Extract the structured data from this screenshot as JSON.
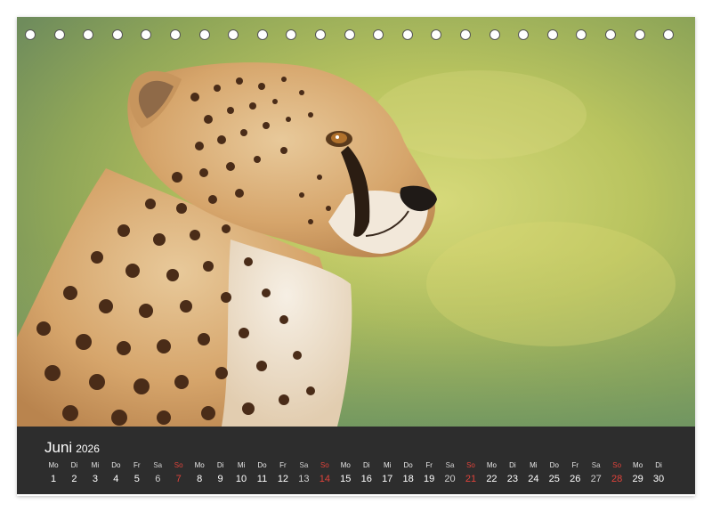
{
  "calendar": {
    "month": "Juni",
    "year": "2026",
    "days": [
      {
        "dow": "Mo",
        "num": "1",
        "type": "weekday"
      },
      {
        "dow": "Di",
        "num": "2",
        "type": "weekday"
      },
      {
        "dow": "Mi",
        "num": "3",
        "type": "weekday"
      },
      {
        "dow": "Do",
        "num": "4",
        "type": "weekday"
      },
      {
        "dow": "Fr",
        "num": "5",
        "type": "weekday"
      },
      {
        "dow": "Sa",
        "num": "6",
        "type": "sat"
      },
      {
        "dow": "So",
        "num": "7",
        "type": "sun"
      },
      {
        "dow": "Mo",
        "num": "8",
        "type": "weekday"
      },
      {
        "dow": "Di",
        "num": "9",
        "type": "weekday"
      },
      {
        "dow": "Mi",
        "num": "10",
        "type": "weekday"
      },
      {
        "dow": "Do",
        "num": "11",
        "type": "weekday"
      },
      {
        "dow": "Fr",
        "num": "12",
        "type": "weekday"
      },
      {
        "dow": "Sa",
        "num": "13",
        "type": "sat"
      },
      {
        "dow": "So",
        "num": "14",
        "type": "sun"
      },
      {
        "dow": "Mo",
        "num": "15",
        "type": "weekday"
      },
      {
        "dow": "Di",
        "num": "16",
        "type": "weekday"
      },
      {
        "dow": "Mi",
        "num": "17",
        "type": "weekday"
      },
      {
        "dow": "Do",
        "num": "18",
        "type": "weekday"
      },
      {
        "dow": "Fr",
        "num": "19",
        "type": "weekday"
      },
      {
        "dow": "Sa",
        "num": "20",
        "type": "sat"
      },
      {
        "dow": "So",
        "num": "21",
        "type": "sun"
      },
      {
        "dow": "Mo",
        "num": "22",
        "type": "weekday"
      },
      {
        "dow": "Di",
        "num": "23",
        "type": "weekday"
      },
      {
        "dow": "Mi",
        "num": "24",
        "type": "weekday"
      },
      {
        "dow": "Do",
        "num": "25",
        "type": "weekday"
      },
      {
        "dow": "Fr",
        "num": "26",
        "type": "weekday"
      },
      {
        "dow": "Sa",
        "num": "27",
        "type": "sat"
      },
      {
        "dow": "So",
        "num": "28",
        "type": "sun"
      },
      {
        "dow": "Mo",
        "num": "29",
        "type": "weekday"
      },
      {
        "dow": "Di",
        "num": "30",
        "type": "weekday"
      }
    ]
  },
  "binding": {
    "hole_count": 23
  },
  "photo": {
    "subject": "cheetah-photo"
  },
  "colors": {
    "strip_background": "#2d2d2d",
    "sunday_red": "#e0433b",
    "text_white": "#ffffff"
  }
}
